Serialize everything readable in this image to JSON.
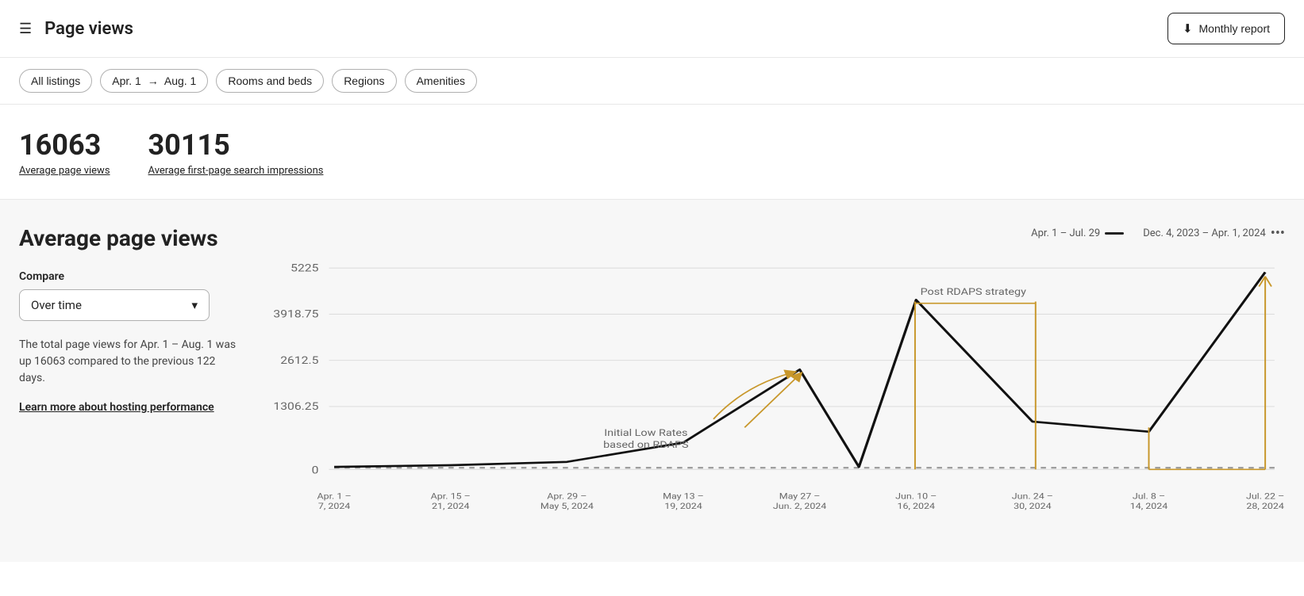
{
  "header": {
    "menu_icon": "☰",
    "title": "Page views",
    "monthly_report_label": "Monthly report",
    "download_icon": "↓"
  },
  "filters": [
    {
      "label": "All listings",
      "id": "all-listings"
    },
    {
      "label": "Apr. 1 → Aug. 1",
      "id": "date-range"
    },
    {
      "label": "Rooms and beds",
      "id": "rooms-beds"
    },
    {
      "label": "Regions",
      "id": "regions"
    },
    {
      "label": "Amenities",
      "id": "amenities"
    }
  ],
  "stats": {
    "page_views_value": "16063",
    "page_views_label": "Average page views",
    "impressions_value": "30115",
    "impressions_label": "Average first-page search impressions"
  },
  "chart_section": {
    "title": "Average page views",
    "compare_label": "Compare",
    "compare_value": "Over time",
    "description": "The total page views for Apr. 1 – Aug. 1 was up 16063 compared to the previous 122 days.",
    "learn_more_label": "Learn more about hosting performance",
    "legend": {
      "series1_label": "Apr. 1 – Jul. 29",
      "series2_label": "Dec. 4, 2023 – Apr. 1, 2024"
    },
    "y_axis": [
      "5225",
      "3918.75",
      "2612.5",
      "1306.25",
      "0"
    ],
    "x_axis": [
      "Apr. 1 – 7, 2024",
      "Apr. 15 – 21, 2024",
      "Apr. 29 – May 5, 2024",
      "May 13 – 19, 2024",
      "May 27 – Jun. 2, 2024",
      "Jun. 10 – 16, 2024",
      "Jun. 24 – 30, 2024",
      "Jul. 8 – 14, 2024",
      "Jul. 22 – 28, 2024"
    ],
    "annotations": [
      {
        "label": "Initial Low Rates\nbased on RDAPS"
      },
      {
        "label": "Post RDAPS strategy"
      }
    ]
  }
}
